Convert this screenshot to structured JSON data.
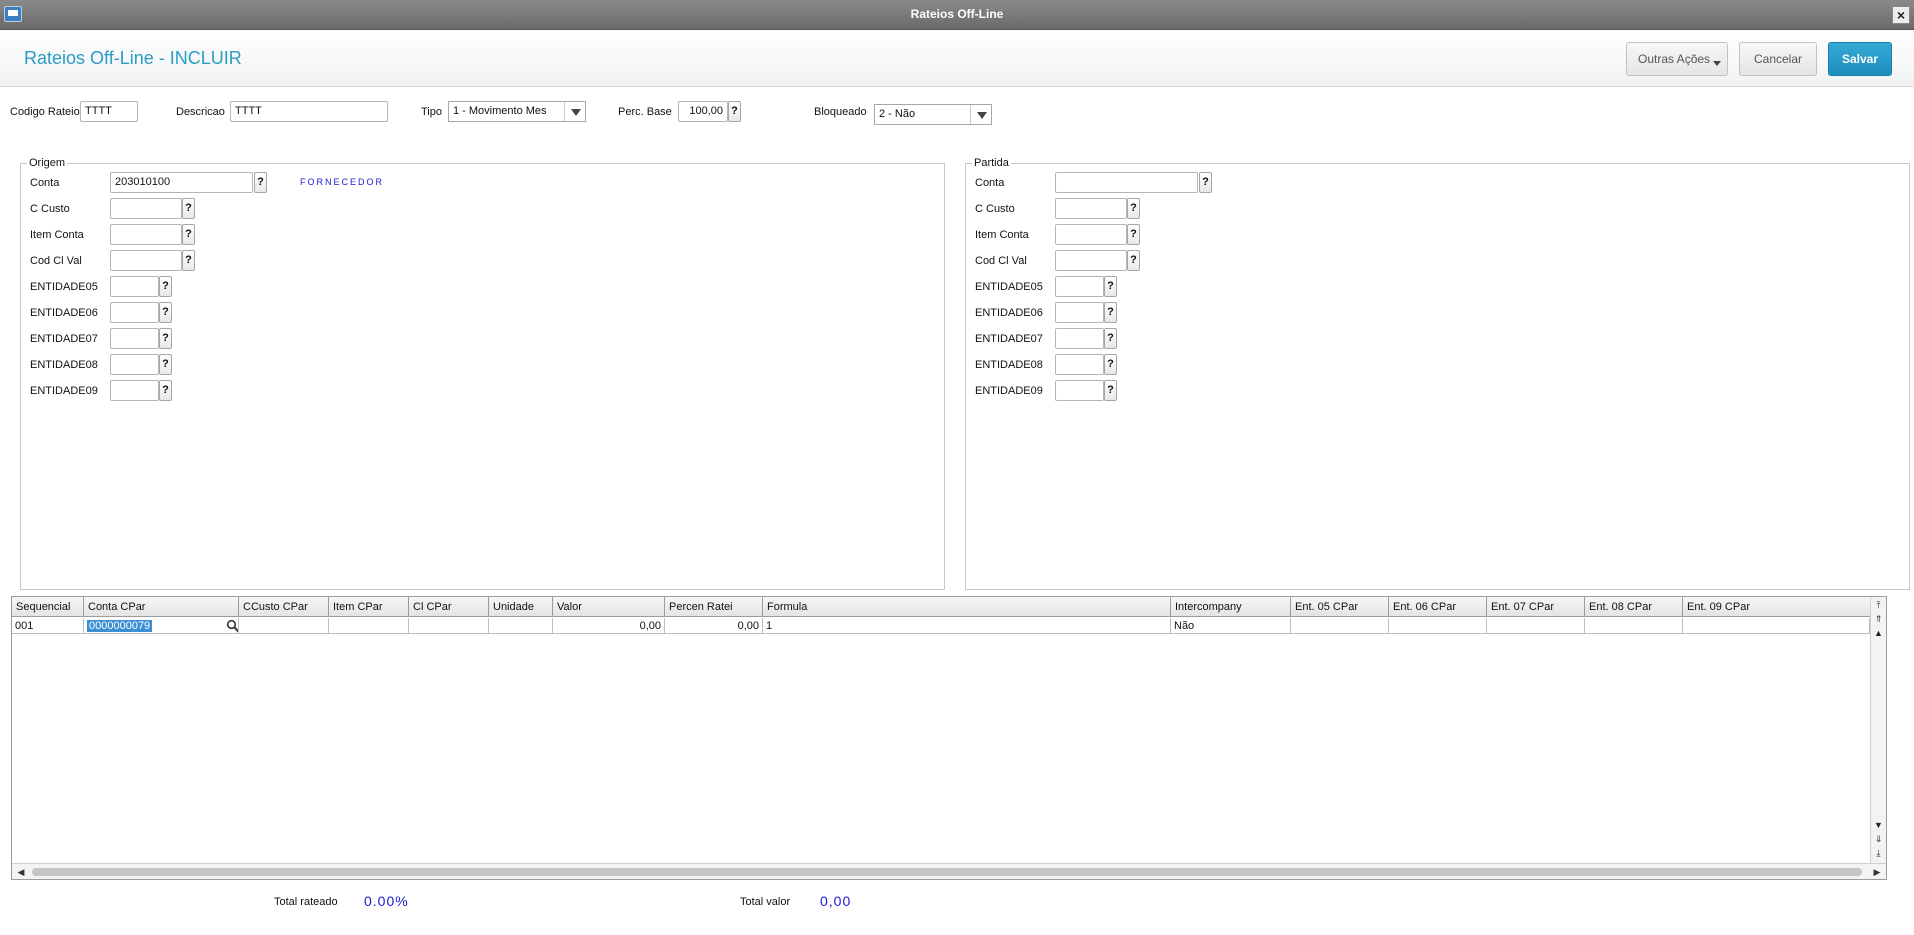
{
  "window": {
    "title": "Rateios Off-Line"
  },
  "header": {
    "title": "Rateios Off-Line - INCLUIR",
    "outras_acoes": "Outras Ações",
    "cancelar": "Cancelar",
    "salvar": "Salvar"
  },
  "form": {
    "codigo_rateio": {
      "label": "Codigo Rateio",
      "value": "TTTT"
    },
    "descricao": {
      "label": "Descricao",
      "value": "TTTT"
    },
    "tipo": {
      "label": "Tipo",
      "value": "1 - Movimento Mes"
    },
    "perc_base": {
      "label": "Perc. Base",
      "value": "100,00"
    },
    "bloqueado": {
      "label": "Bloqueado",
      "value": "2 - Não"
    },
    "help": "?"
  },
  "origem": {
    "title": "Origem",
    "conta": {
      "label": "Conta",
      "value": "203010100",
      "desc": "FORNECEDOR"
    },
    "c_custo": {
      "label": "C Custo",
      "value": ""
    },
    "item_conta": {
      "label": "Item Conta",
      "value": ""
    },
    "cod_cl_val": {
      "label": "Cod Cl Val",
      "value": ""
    },
    "ent05": {
      "label": "ENTIDADE05",
      "value": ""
    },
    "ent06": {
      "label": "ENTIDADE06",
      "value": ""
    },
    "ent07": {
      "label": "ENTIDADE07",
      "value": ""
    },
    "ent08": {
      "label": "ENTIDADE08",
      "value": ""
    },
    "ent09": {
      "label": "ENTIDADE09",
      "value": ""
    }
  },
  "partida": {
    "title": "Partida",
    "conta": {
      "label": "Conta",
      "value": ""
    },
    "c_custo": {
      "label": "C Custo",
      "value": ""
    },
    "item_conta": {
      "label": "Item Conta",
      "value": ""
    },
    "cod_cl_val": {
      "label": "Cod Cl Val",
      "value": ""
    },
    "ent05": {
      "label": "ENTIDADE05",
      "value": ""
    },
    "ent06": {
      "label": "ENTIDADE06",
      "value": ""
    },
    "ent07": {
      "label": "ENTIDADE07",
      "value": ""
    },
    "ent08": {
      "label": "ENTIDADE08",
      "value": ""
    },
    "ent09": {
      "label": "ENTIDADE09",
      "value": ""
    }
  },
  "grid": {
    "columns": [
      "Sequencial",
      "Conta CPar",
      "CCusto CPar",
      "Item CPar",
      "Cl CPar",
      "Unidade",
      "Valor",
      "Percen Ratei",
      "Formula",
      "Intercompany",
      "Ent. 05 CPar",
      "Ent. 06 CPar",
      "Ent. 07 CPar",
      "Ent. 08 CPar",
      "Ent. 09 CPar"
    ],
    "rows": [
      [
        "001",
        "0000000079",
        "",
        "",
        "",
        "",
        "0,00",
        "0,00",
        "1",
        "Não",
        "",
        "",
        "",
        "",
        ""
      ]
    ]
  },
  "totals": {
    "rateado_label": "Total rateado",
    "rateado_value": "0.00%",
    "valor_label": "Total valor",
    "valor_value": "0,00"
  },
  "icons": {
    "lookup": "search-icon",
    "close": "close-icon"
  }
}
